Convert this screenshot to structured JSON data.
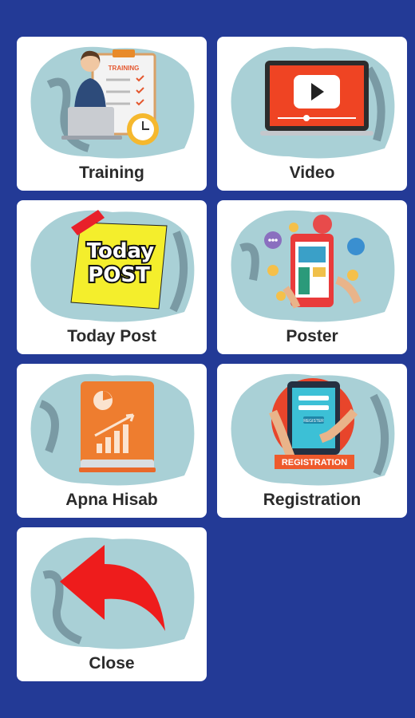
{
  "tiles": [
    {
      "id": "training",
      "label": "Training",
      "icon": "training-icon",
      "art_text": "TRAINING"
    },
    {
      "id": "video",
      "label": "Video",
      "icon": "video-player-icon"
    },
    {
      "id": "today-post",
      "label": "Today Post",
      "icon": "sticky-note-icon",
      "art_text_line1": "Today",
      "art_text_line2": "POST"
    },
    {
      "id": "poster",
      "label": "Poster",
      "icon": "social-media-poster-icon"
    },
    {
      "id": "apna-hisab",
      "label": "Apna Hisab",
      "icon": "account-book-icon"
    },
    {
      "id": "registration",
      "label": "Registration",
      "icon": "registration-tablet-icon",
      "art_text": "REGISTRATION",
      "art_subtext": "REGISTER"
    },
    {
      "id": "close",
      "label": "Close",
      "icon": "back-arrow-icon"
    }
  ],
  "colors": {
    "background": "#233a96",
    "tile": "#ffffff",
    "blob": "#a9d0d6",
    "blob_dark": "#7a9aa4",
    "label": "#2b2b2b"
  }
}
